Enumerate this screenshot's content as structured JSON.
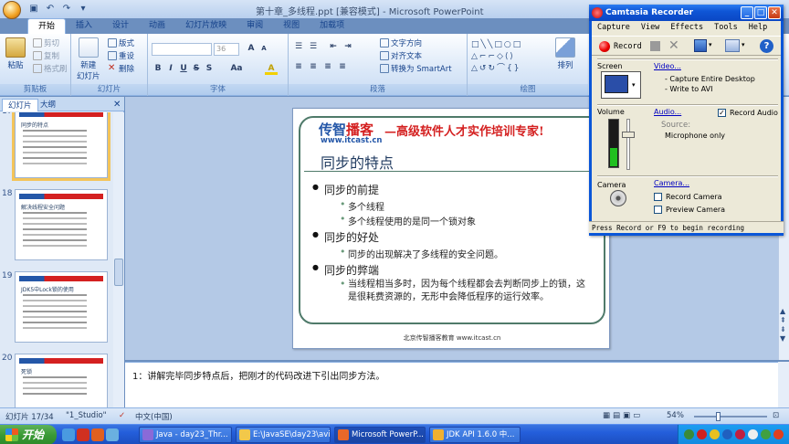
{
  "powerpoint": {
    "doc_title": "第十章_多线程.ppt [兼容模式] - Microsoft PowerPoint",
    "tabs": [
      "开始",
      "插入",
      "设计",
      "动画",
      "幻灯片放映",
      "审阅",
      "视图",
      "加载项"
    ],
    "active_tab": "开始",
    "ribbon": {
      "clipboard": {
        "label": "剪贴板",
        "paste": "粘贴",
        "cut": "剪切",
        "copy": "复制",
        "format_painter": "格式刷"
      },
      "slides": {
        "label": "幻灯片",
        "new_slide": "新建\n幻灯片",
        "layout": "版式",
        "reset": "重设",
        "delete": "删除"
      },
      "font": {
        "label": "字体",
        "font_name": "",
        "font_size": "36"
      },
      "paragraph": {
        "label": "段落",
        "text_direction": "文字方向",
        "align_text": "对齐文本",
        "smartart": "转换为 SmartArt"
      },
      "drawing": {
        "label": "绘图",
        "arrange": "排列",
        "quick_styles": "快速样式"
      }
    },
    "left_pane": {
      "tab_slides": "幻灯片",
      "tab_outline": "大纲",
      "thumbnails": [
        {
          "num": "17",
          "selected": true,
          "title": "同步的特点"
        },
        {
          "num": "18",
          "selected": false,
          "title": "解决线程安全问题"
        },
        {
          "num": "19",
          "selected": false,
          "title": "JDK5中Lock锁的使用"
        },
        {
          "num": "20",
          "selected": false,
          "title": "死锁"
        }
      ]
    },
    "slide": {
      "logo_part1": "传智",
      "logo_part2": "播客",
      "logo_url": "www.itcast.cn",
      "slogan": "—高级软件人才实作培训专家!",
      "title": "同步的特点",
      "bullets": [
        {
          "text": "同步的前提",
          "sub": [
            "多个线程",
            "多个线程使用的是同一个锁对象"
          ]
        },
        {
          "text": "同步的好处",
          "sub": [
            "同步的出现解决了多线程的安全问题。"
          ]
        },
        {
          "text": "同步的弊端",
          "sub": [
            "当线程相当多时，因为每个线程都会去判断同步上的锁，这是很耗费资源的，无形中会降低程序的运行效率。"
          ]
        }
      ],
      "footer": "北京传智播客教育 www.itcast.cn"
    },
    "notes": "1：讲解完毕同步特点后，把刚才的代码改进下引出同步方法。",
    "status": {
      "slide_pos": "幻灯片 17/34",
      "theme": "\"1_Studio\"",
      "language": "中文(中国)",
      "zoom": "54%"
    }
  },
  "camtasia": {
    "title": "Camtasia Recorder",
    "menu": [
      "Capture",
      "View",
      "Effects",
      "Tools",
      "Help"
    ],
    "record_label": "Record",
    "screen": {
      "label": "Screen",
      "link": "Video...",
      "lines": [
        "- Capture Entire Desktop",
        "- Write to AVI"
      ]
    },
    "volume": {
      "label": "Volume",
      "link": "Audio...",
      "record_audio": "Record Audio",
      "record_audio_checked": true,
      "source_label": "Source:",
      "source_value": "Microphone only"
    },
    "camera": {
      "label": "Camera",
      "link": "Camera...",
      "record_camera": "Record Camera",
      "preview_camera": "Preview Camera"
    },
    "status": "Press Record or F9 to begin recording"
  },
  "taskbar": {
    "start": "开始",
    "tasks": [
      {
        "label": "Java - day23_Thr...",
        "color": "#8a6ad8"
      },
      {
        "label": "E:\\JavaSE\\day23\\avi",
        "color": "#f2c84a"
      },
      {
        "label": "Microsoft PowerP...",
        "color": "#e8682a"
      },
      {
        "label": "JDK API 1.6.0 中...",
        "color": "#f0b030"
      }
    ]
  }
}
